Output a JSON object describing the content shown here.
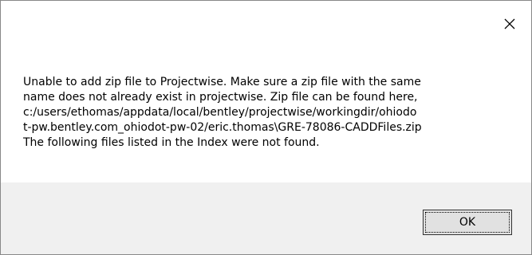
{
  "dialog": {
    "close_icon": "close-icon",
    "message_lines": [
      "Unable to add zip file to Projectwise. Make sure a zip file with the same",
      "name does not already exist in projectwise. Zip file can be found here,",
      "c:/users/ethomas/appdata/local/bentley/projectwise/workingdir/ohiodo",
      "t-pw.bentley.com_ohiodot-pw-02/eric.thomas\\GRE-78086-CADDFiles.zip",
      "The following files listed in the Index were not found."
    ],
    "ok_label": "OK"
  },
  "colors": {
    "dialog_background": "#ffffff",
    "button_bar_background": "#f0f0f0",
    "button_face": "#e1e1e1",
    "text": "#000000"
  }
}
